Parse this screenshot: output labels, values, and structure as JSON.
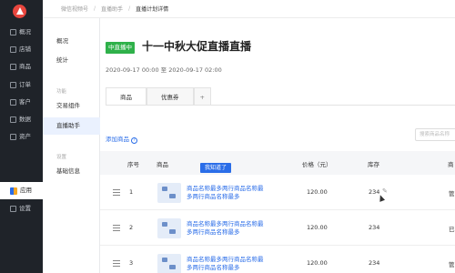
{
  "sidebar": {
    "items": [
      {
        "label": "概况"
      },
      {
        "label": "店铺"
      },
      {
        "label": "商品"
      },
      {
        "label": "订单"
      },
      {
        "label": "客户"
      },
      {
        "label": "数据"
      },
      {
        "label": "资产"
      },
      {
        "label": "应用"
      },
      {
        "label": "设置"
      }
    ]
  },
  "breadcrumb": [
    "微信视频号",
    "直播助手",
    "直播计划详情"
  ],
  "subnav": {
    "items": [
      {
        "label": "概况"
      },
      {
        "label": "统计"
      },
      {
        "label": "交易组件"
      },
      {
        "label": "直播助手"
      },
      {
        "label": "基础信息"
      }
    ],
    "groups": [
      "功能",
      "设置"
    ]
  },
  "header": {
    "badge": "中直播中",
    "title": "十一中秋大促直播直播",
    "time": "2020-09-17 00:00  至  2020-09-17 02:00"
  },
  "tabs": [
    "商品",
    "优惠券",
    "+"
  ],
  "actions": {
    "add_product": "添加商品",
    "help": "?",
    "search_placeholder": "搜索商品名称"
  },
  "table": {
    "headers": [
      "序号",
      "商品",
      "价格（元）",
      "库存",
      "商"
    ],
    "tooltip": "我知道了",
    "rows": [
      {
        "index": "1",
        "name": "商品名称最多两行商品名称最多两行商品名称最多",
        "price": "120.00",
        "stock": "234",
        "edit": "✎",
        "extra": "管"
      },
      {
        "index": "2",
        "name": "商品名称最多两行商品名称最多两行商品名称最多",
        "price": "120.00",
        "stock": "234",
        "extra": "已"
      },
      {
        "index": "3",
        "name": "商品名称最多两行商品名称最多两行商品名称最多",
        "price": "120.00",
        "stock": "234",
        "extra": "管"
      }
    ]
  },
  "colors": {
    "accent": "#2a6de8",
    "live": "#2fb14a",
    "sidebar": "#1f2329"
  }
}
